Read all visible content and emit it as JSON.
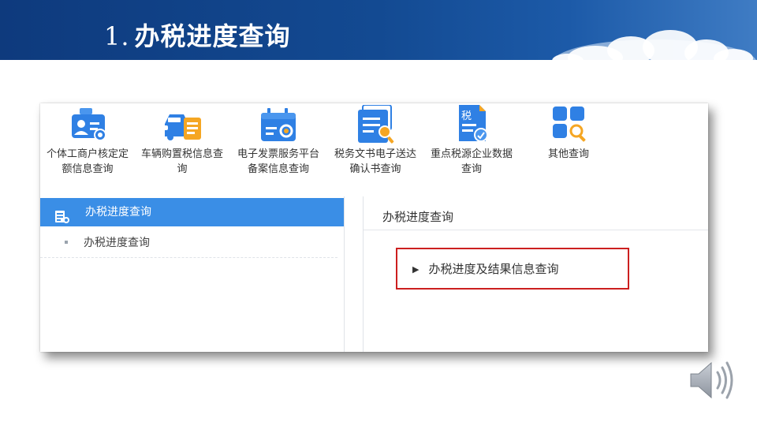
{
  "slide": {
    "title_number": "1.",
    "title_text": "办税进度查询"
  },
  "shortcuts": [
    {
      "label": "个体工商户核定定额信息查询",
      "icon": "id-card-search-icon"
    },
    {
      "label": "车辆购置税信息查询",
      "icon": "vehicle-icon"
    },
    {
      "label": "电子发票服务平台备案信息查询",
      "icon": "calendar-search-icon"
    },
    {
      "label": "税务文书电子送达确认书查询",
      "icon": "document-search-icon"
    },
    {
      "label": "重点税源企业数据查询",
      "icon": "tax-document-icon"
    },
    {
      "label": "其他查询",
      "icon": "grid-search-icon"
    }
  ],
  "tax_document_icon_text": "税",
  "sidebar": {
    "header": "办税进度查询",
    "items": [
      {
        "label": "办税进度查询"
      }
    ]
  },
  "content": {
    "title": "办税进度查询",
    "link_arrow": "▶",
    "link_label": "办税进度及结果信息查询"
  },
  "colors": {
    "banner": "#134a92",
    "accent": "#3a8ee6",
    "highlight_border": "#cc1f1f",
    "icon_blue": "#2f80e4"
  }
}
